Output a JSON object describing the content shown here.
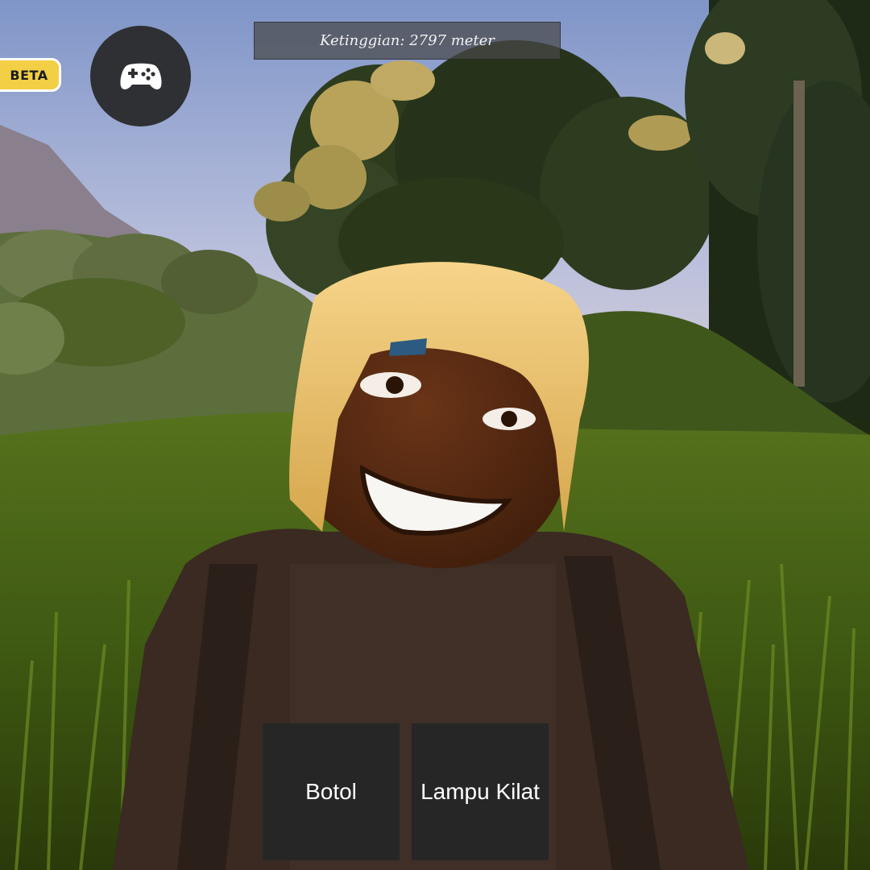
{
  "hud": {
    "beta_label": "BETA",
    "altitude_text": "Ketinggian: 2797 meter",
    "menu_icon": "gamepad-icon"
  },
  "hotbar": {
    "slots": [
      {
        "label": "Botol"
      },
      {
        "label": "Lampu Kilat"
      }
    ]
  },
  "colors": {
    "beta_badge": "#f2cf45",
    "round_button": "#2e3033",
    "hotbar_slot": "#262626"
  }
}
